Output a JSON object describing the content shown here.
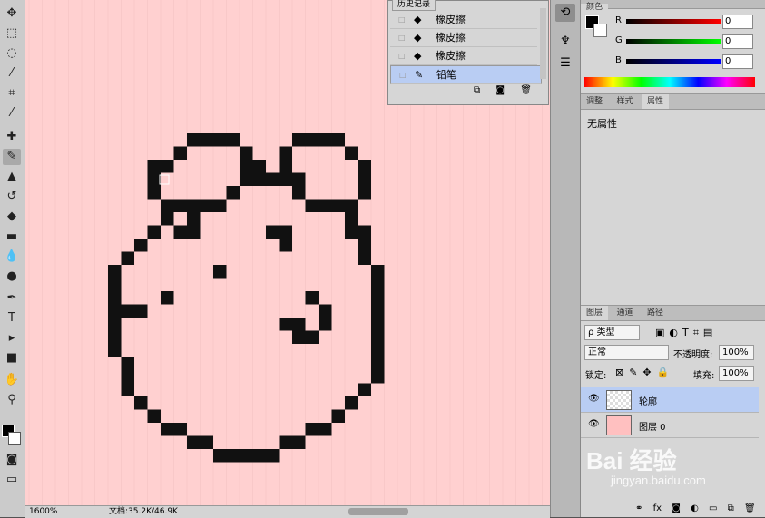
{
  "history": {
    "tab": "历史记录",
    "items": [
      {
        "icon": "eraser-icon",
        "glyph": "◆",
        "label": "橡皮擦"
      },
      {
        "icon": "eraser-icon",
        "glyph": "◆",
        "label": "橡皮擦"
      },
      {
        "icon": "eraser-icon",
        "glyph": "◆",
        "label": "橡皮擦"
      },
      {
        "icon": "pencil-icon",
        "glyph": "✎",
        "label": "铅笔"
      }
    ]
  },
  "color": {
    "tabs": [
      "颜色"
    ],
    "r_label": "R",
    "g_label": "G",
    "b_label": "B",
    "r_value": "0",
    "g_value": "0",
    "b_value": "0"
  },
  "properties": {
    "tabs": [
      "调整",
      "样式",
      "属性"
    ],
    "active_tab": "属性",
    "empty_text": "无属性"
  },
  "layers": {
    "tabs": [
      "图层",
      "通道",
      "路径"
    ],
    "filter_label": "ρ 类型",
    "blend_mode": "正常",
    "opacity_label": "不透明度:",
    "opacity_value": "100%",
    "lock_label": "锁定:",
    "fill_label": "填充:",
    "fill_value": "100%",
    "items": [
      {
        "name": "轮廓",
        "selected": true
      },
      {
        "name": "图层 0",
        "selected": false
      }
    ]
  },
  "status": {
    "zoom": "1600%",
    "doc": "文档:35.2K/46.9K"
  },
  "watermark": {
    "logo": "Bai 经验",
    "url": "jingyan.baidu.com"
  },
  "canvas": {
    "background": "#ffd0d0",
    "pixel_color": "#111111"
  }
}
